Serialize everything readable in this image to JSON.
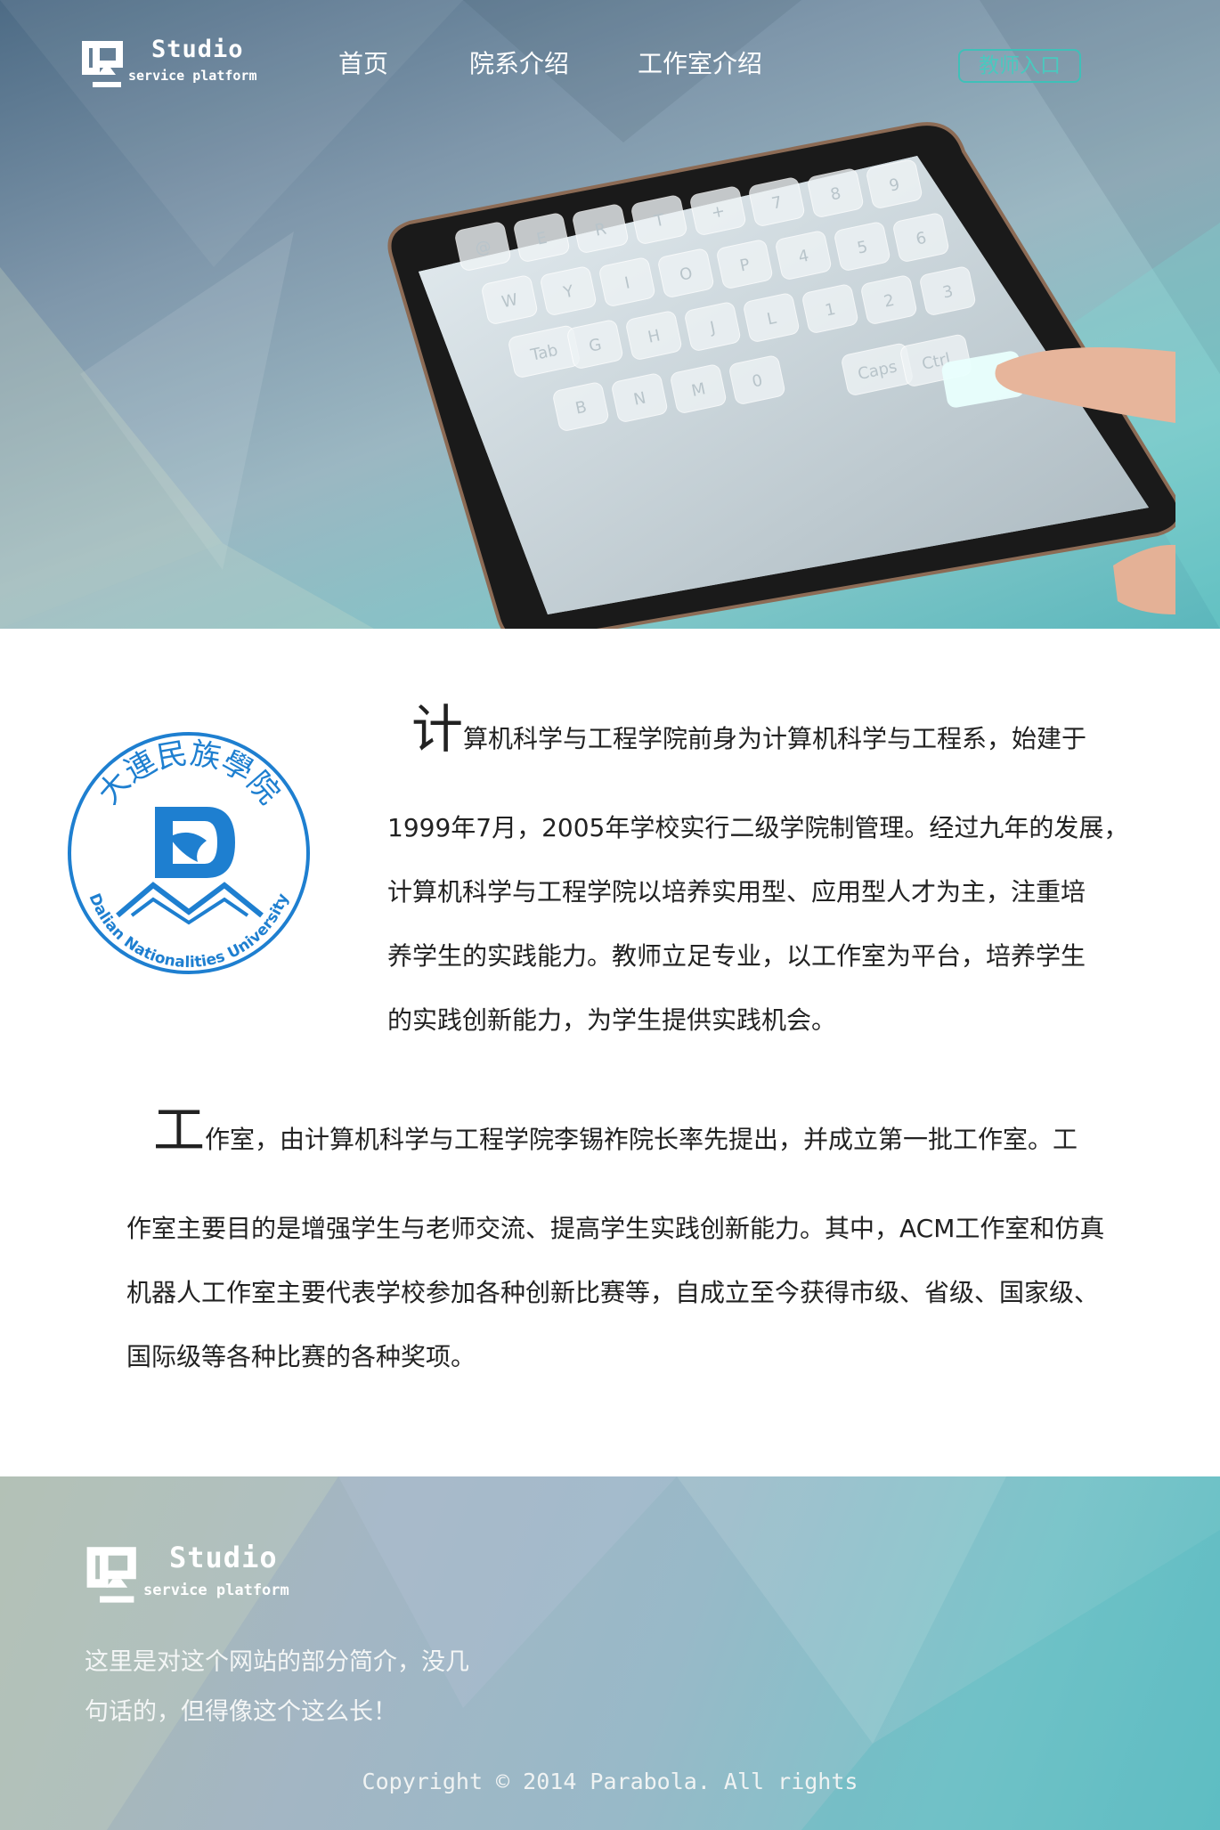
{
  "brand": {
    "name": "Studio",
    "tagline": "service platform"
  },
  "nav": {
    "items": [
      {
        "label": "首页"
      },
      {
        "label": "院系介绍"
      },
      {
        "label": "工作室介绍"
      }
    ],
    "teacher_button": "教师入口"
  },
  "hero": {
    "keyboard_keys": [
      "@",
      "E",
      "R",
      "T",
      "+",
      "7",
      "8",
      "9",
      "W",
      "Y",
      "I",
      "O",
      "P",
      "4",
      "5",
      "6",
      "Tab",
      "G",
      "H",
      "J",
      "L",
      "1",
      "2",
      "3",
      "B",
      "N",
      "M",
      "0",
      "Caps",
      "Ctrl"
    ]
  },
  "university_logo": {
    "chinese_name": "大連民族學院",
    "english_name": "Dalian Nationalities University"
  },
  "intro_paragraph_1": {
    "dropcap": "计",
    "lines": [
      "算机科学与工程学院前身为计算机科学与工程系，始建于",
      "1999年7月，2005年学校实行二级学院制管理。经过九年的发展，",
      "计算机科学与工程学院以培养实用型、应用型人才为主，注重培",
      "养学生的实践能力。教师立足专业，以工作室为平台，培养学生",
      "的实践创新能力，为学生提供实践机会。"
    ]
  },
  "intro_paragraph_2": {
    "dropcap": "工",
    "lines": [
      "作室，由计算机科学与工程学院李锡祚院长率先提出，并成立第一批工作室。工",
      "作室主要目的是增强学生与老师交流、提高学生实践创新能力。其中，ACM工作室和仿真",
      "机器人工作室主要代表学校参加各种创新比赛等，自成立至今获得市级、省级、国家级、",
      "国际级等各种比赛的各种奖项。"
    ]
  },
  "footer": {
    "brand": {
      "name": "Studio",
      "tagline": "service platform"
    },
    "intro_lines": [
      "这里是对这个网站的部分简介，没几",
      "句话的，但得像这个这么长！"
    ],
    "copyright": "Copyright © 2014 Parabola. All rights"
  },
  "colors": {
    "accent": "#49c9bf",
    "text": "#222222",
    "white": "#ffffff"
  }
}
